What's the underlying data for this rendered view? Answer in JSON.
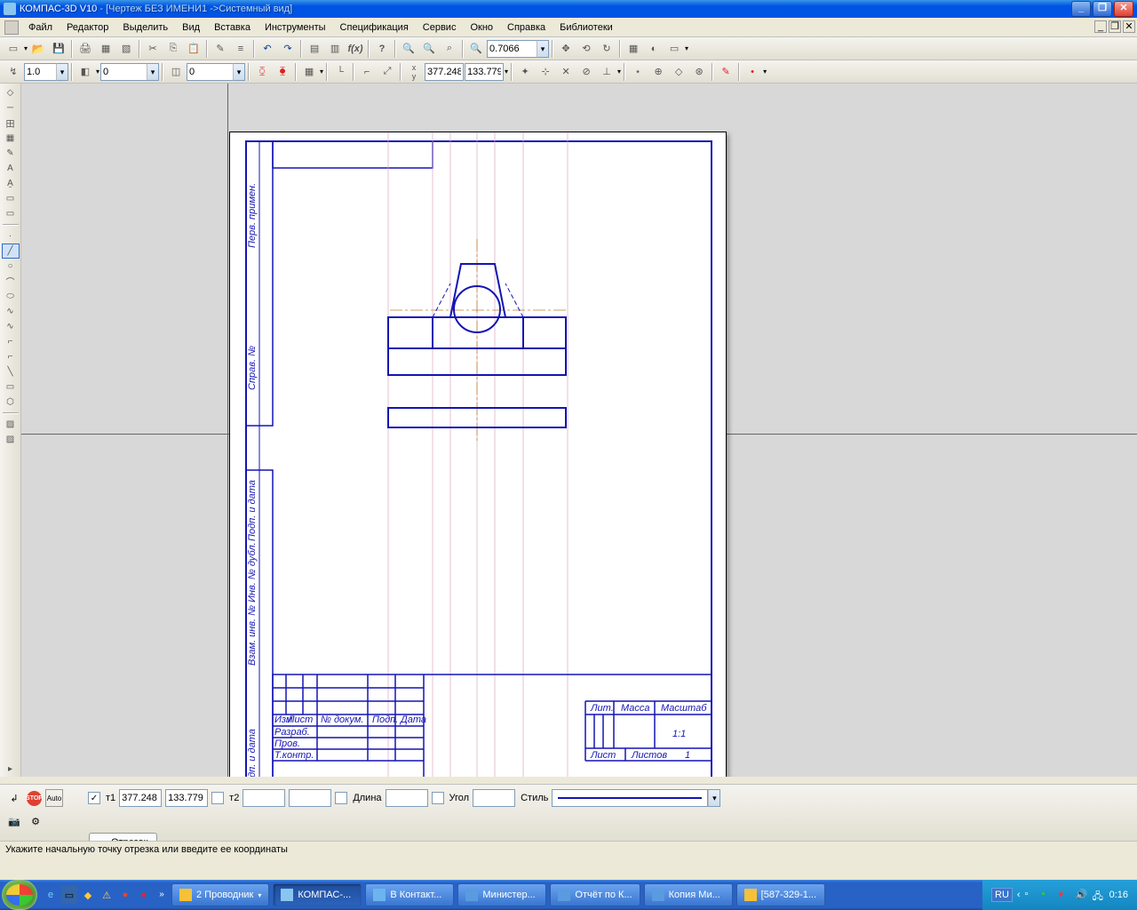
{
  "title": {
    "app": "КОМПАС-3D V10",
    "doc": " - [Чертеж БЕЗ ИМЕНИ1 ->Системный вид]"
  },
  "menu": [
    "Файл",
    "Редактор",
    "Выделить",
    "Вид",
    "Вставка",
    "Инструменты",
    "Спецификация",
    "Сервис",
    "Окно",
    "Справка",
    "Библиотеки"
  ],
  "toolbar1": {
    "zoom": "0.7066"
  },
  "toolbar2": {
    "step": "1.0",
    "view": "0",
    "layer": "0",
    "cx": "377.248",
    "cy": "133.779"
  },
  "param_panel": {
    "t1_label": "т1",
    "t1x": "377.248",
    "t1y": "133.779",
    "t2_label": "т2",
    "len_label": "Длина",
    "ang_label": "Угол",
    "style_label": "Стиль"
  },
  "tab": "Отрезок",
  "status": "Укажите начальную точку отрезка или введите ее координаты",
  "stamp": {
    "r1c1": "Изм",
    "r1c2": "Лист",
    "r1c3": "№ докум.",
    "r1c4": "Подп.",
    "r1c5": "Дата",
    "razrab": "Разраб.",
    "prov": "Пров.",
    "tkontr": "Т.контр.",
    "lit": "Лит.",
    "massa": "Масса",
    "masshtab": "Масштаб",
    "scale": "1:1",
    "list": "Лист",
    "listov": "Листов",
    "listov_v": "1"
  },
  "vtext": {
    "a": "Перв. примен.",
    "b": "Справ. №",
    "c": "Подп. и дата",
    "d": "Взам. инв. № Инв. № дубл.",
    "e": "Подп. и дата"
  },
  "taskbar": {
    "items": [
      {
        "label": "2 Проводник",
        "icon": "#f5c136",
        "dd": true
      },
      {
        "label": "КОМПАС-...",
        "icon": "#8ac5f0",
        "active": true
      },
      {
        "label": "В Контакт...",
        "icon": "#6bb4f0"
      },
      {
        "label": "Министер...",
        "icon": "#5a9be0"
      },
      {
        "label": "Отчёт по К...",
        "icon": "#5a9be0"
      },
      {
        "label": "Копия Ми...",
        "icon": "#5a9be0"
      },
      {
        "label": "[587-329-1...",
        "icon": "#f5c136"
      }
    ],
    "lang": "RU",
    "time": "0:16"
  }
}
